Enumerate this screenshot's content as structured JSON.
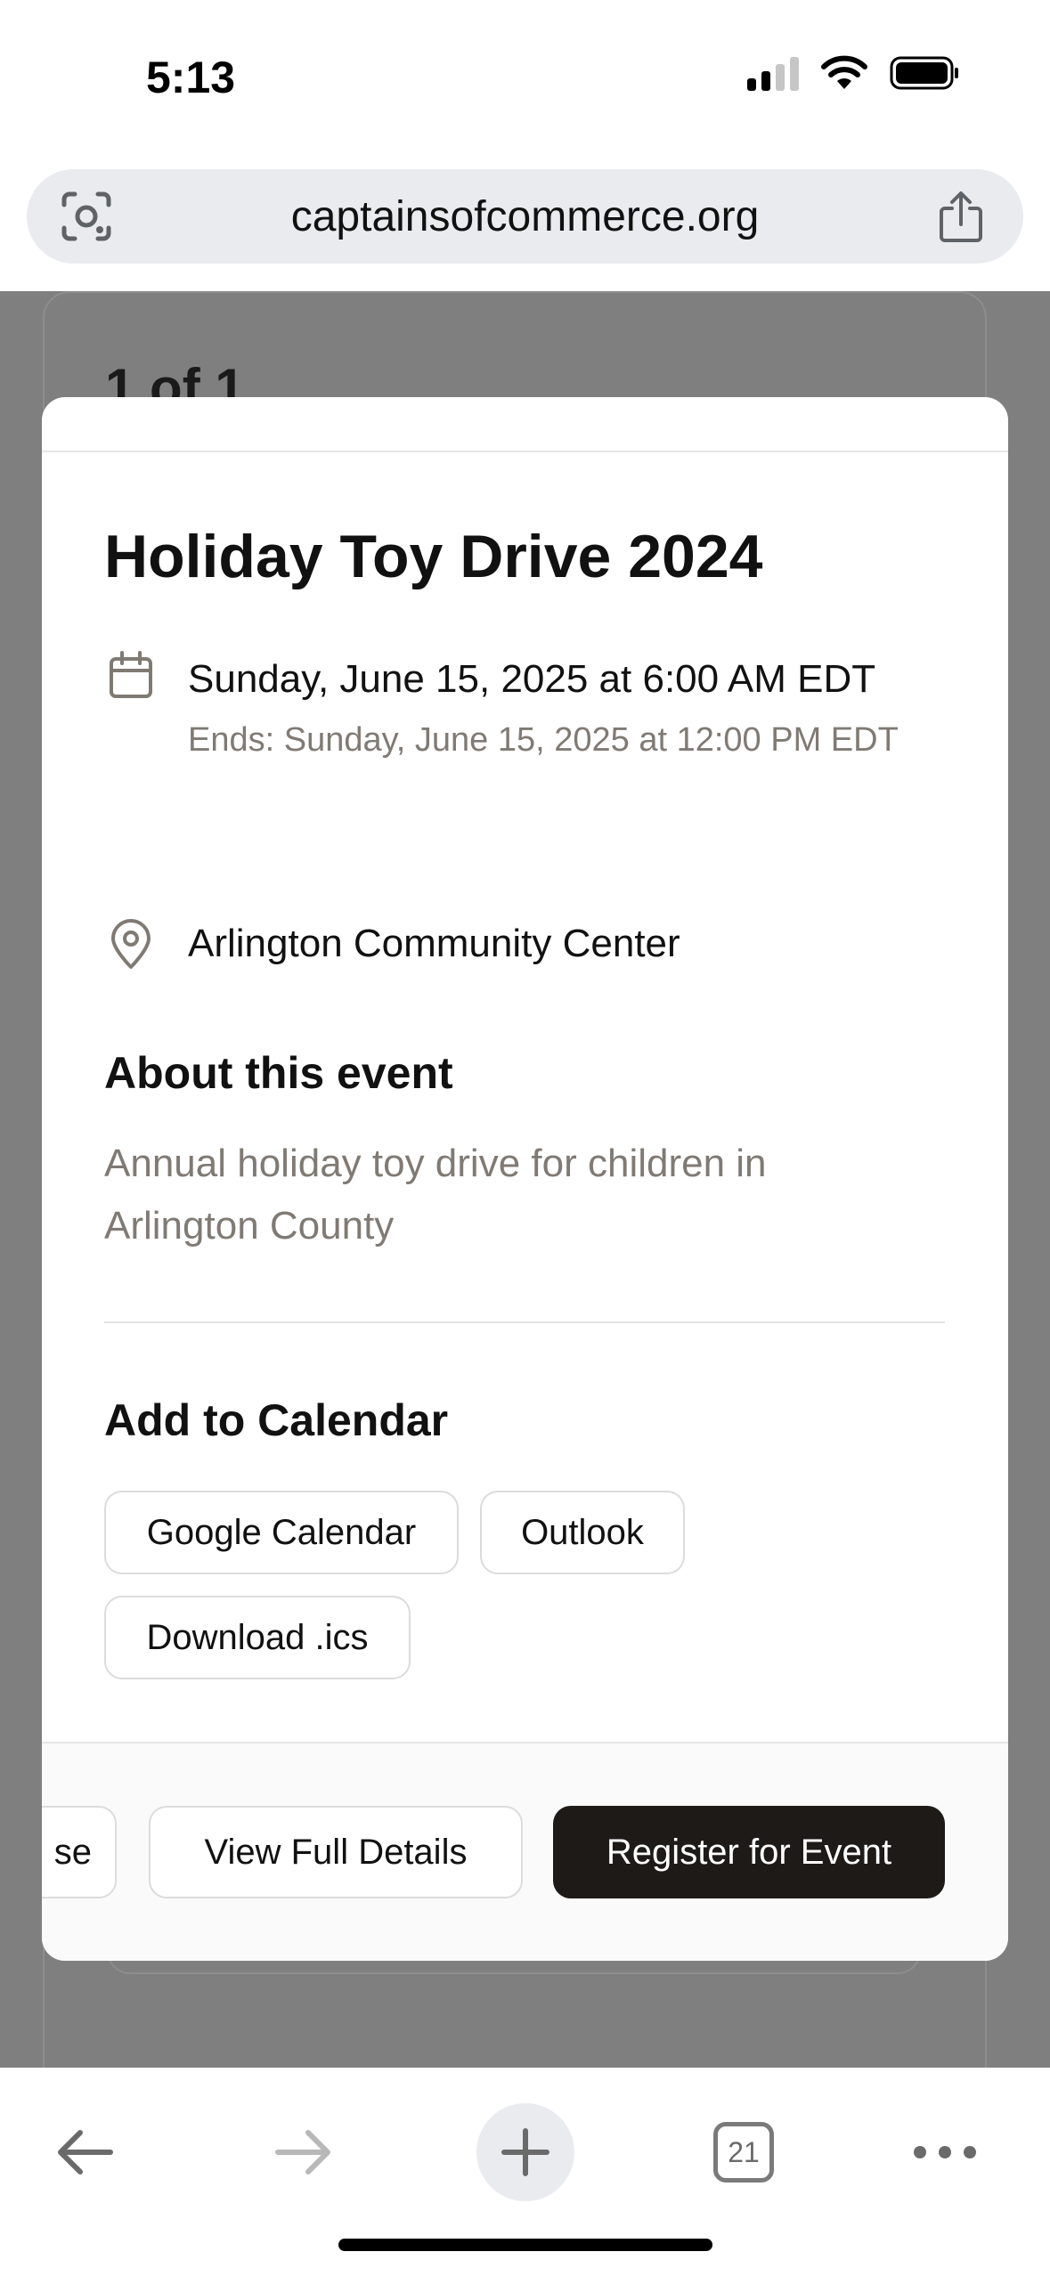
{
  "status_bar": {
    "time": "5:13"
  },
  "browser": {
    "url": "captainsofcommerce.org",
    "tab_count": "21"
  },
  "background": {
    "counter": "1 of 1"
  },
  "event": {
    "title": "Holiday Toy Drive 2024",
    "start": "Sunday, June 15, 2025 at 6:00 AM EDT",
    "ends": "Ends: Sunday, June 15, 2025 at 12:00 PM EDT",
    "location": "Arlington Community Center",
    "about_heading": "About this event",
    "about_text": "Annual holiday toy drive for children in Arlington County"
  },
  "calendar": {
    "heading": "Add to Calendar",
    "google": "Google Calendar",
    "outlook": "Outlook",
    "ics": "Download .ics"
  },
  "footer": {
    "close": "se",
    "view_details": "View Full Details",
    "register": "Register for Event"
  },
  "colors": {
    "primary_button": "#1d1a18",
    "muted_text": "#807a74"
  }
}
